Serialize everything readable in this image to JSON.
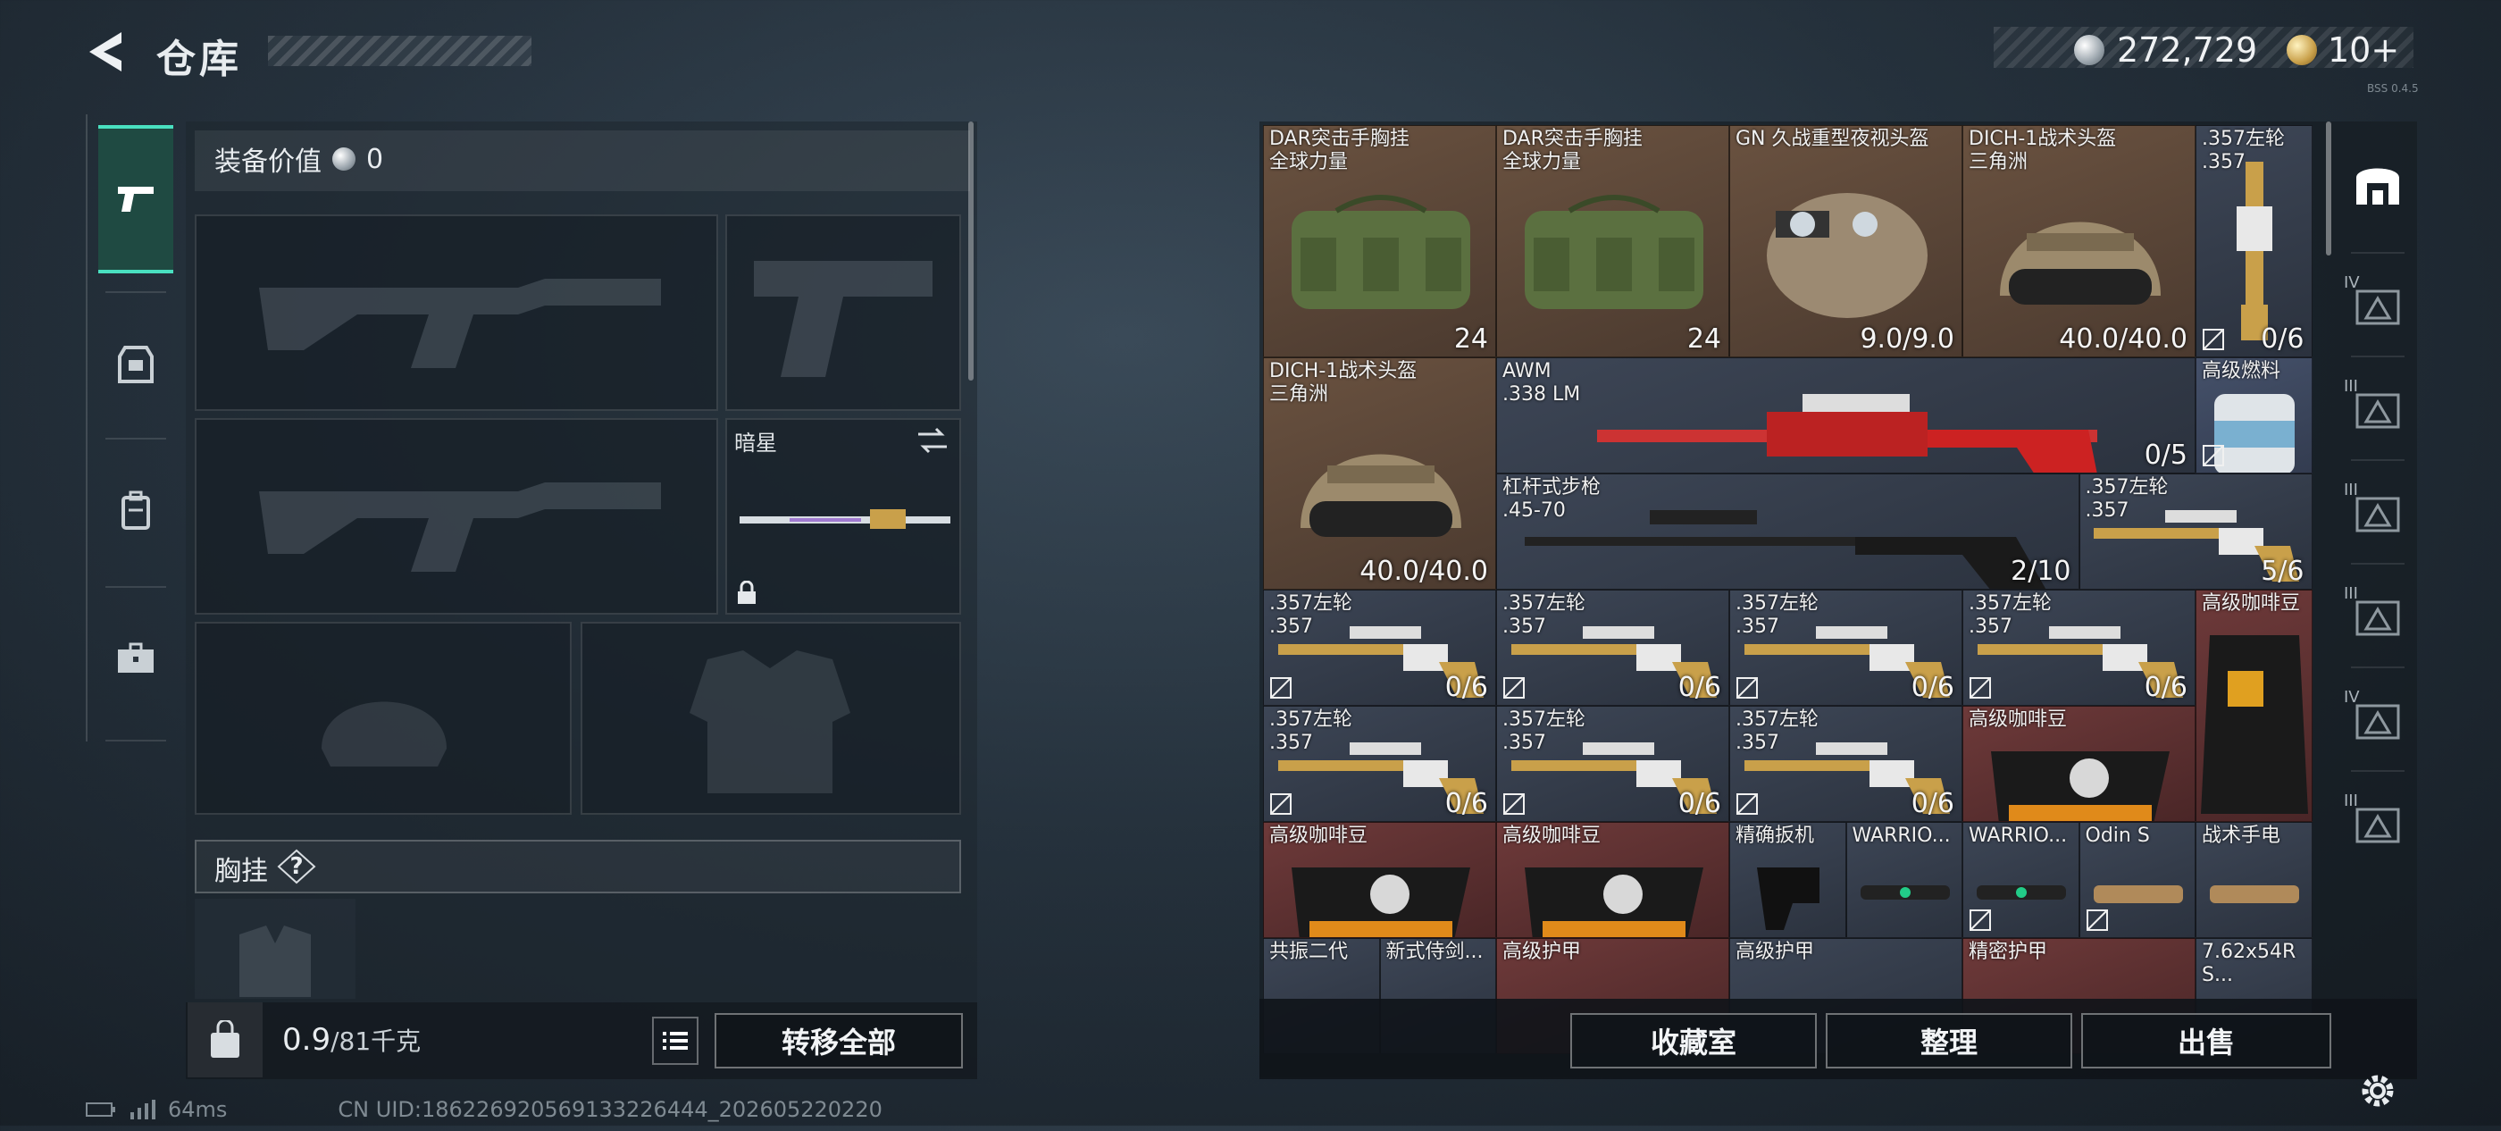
{
  "header": {
    "title": "仓库",
    "silver_amount": "272,729",
    "gold_amount": "10+",
    "version": "BSS 0.4.5"
  },
  "equipment": {
    "value_label": "装备价值",
    "value": "0",
    "melee_name": "暗星",
    "chest_label": "胸挂",
    "chest_help": "?",
    "weight_current": "0.9",
    "weight_max": "/81千克",
    "transfer_all": "转移全部"
  },
  "grid_items": [
    {
      "name": "DAR突击手胸挂\n全球力量",
      "badge": "24"
    },
    {
      "name": "DAR突击手胸挂\n全球力量",
      "badge": "24"
    },
    {
      "name": "GN 久战重型夜视头盔",
      "value": "9.0/9.0"
    },
    {
      "name": "DICH-1战术头盔\n三角洲",
      "value": "40.0/40.0"
    },
    {
      "name": ".357左轮\n.357",
      "value": "0/6"
    },
    {
      "name": "DICH-1战术头盔\n三角洲",
      "value": "40.0/40.0"
    },
    {
      "name": "AWM\n.338 LM",
      "value": "0/5"
    },
    {
      "name": "高级燃料",
      "value": ""
    },
    {
      "name": "杠杆式步枪\n.45-70",
      "value": "2/10"
    },
    {
      "name": ".357左轮\n.357",
      "value": "5/6"
    },
    {
      "name": ".357左轮\n.357",
      "value": "0/6"
    },
    {
      "name": ".357左轮\n.357",
      "value": "0/6"
    },
    {
      "name": ".357左轮\n.357",
      "value": "0/6"
    },
    {
      "name": ".357左轮\n.357",
      "value": "0/6"
    },
    {
      "name": "高级咖啡豆",
      "value": ""
    },
    {
      "name": ".357左轮\n.357",
      "value": "0/6"
    },
    {
      "name": ".357左轮\n.357",
      "value": "0/6"
    },
    {
      "name": ".357左轮\n.357",
      "value": "0/6"
    },
    {
      "name": "高级咖啡豆",
      "value": ""
    },
    {
      "name": "高级咖啡豆",
      "value": ""
    },
    {
      "name": "高级咖啡豆",
      "value": ""
    },
    {
      "name": "精确扳机",
      "value": ""
    },
    {
      "name": "WARRIO...",
      "value": ""
    },
    {
      "name": "WARRIO...",
      "value": ""
    },
    {
      "name": "Odin S",
      "value": ""
    },
    {
      "name": "战术手电",
      "value": ""
    },
    {
      "name": "共振二代",
      "value": ""
    },
    {
      "name": "新式侍剑...",
      "value": ""
    },
    {
      "name": "高级护甲",
      "value": ""
    },
    {
      "name": "高级护甲",
      "value": ""
    },
    {
      "name": "精密护甲",
      "value": ""
    },
    {
      "name": "7.62x54R\nS...",
      "value": ""
    }
  ],
  "buttons": {
    "collection": "收藏室",
    "sort": "整理",
    "sell": "出售"
  },
  "status": {
    "ping": "64ms",
    "uid": "CN UID:186226920569133226444_202605220220"
  },
  "right_nav_labels": [
    "IV",
    "III",
    "III",
    "III",
    "IV",
    "III"
  ]
}
